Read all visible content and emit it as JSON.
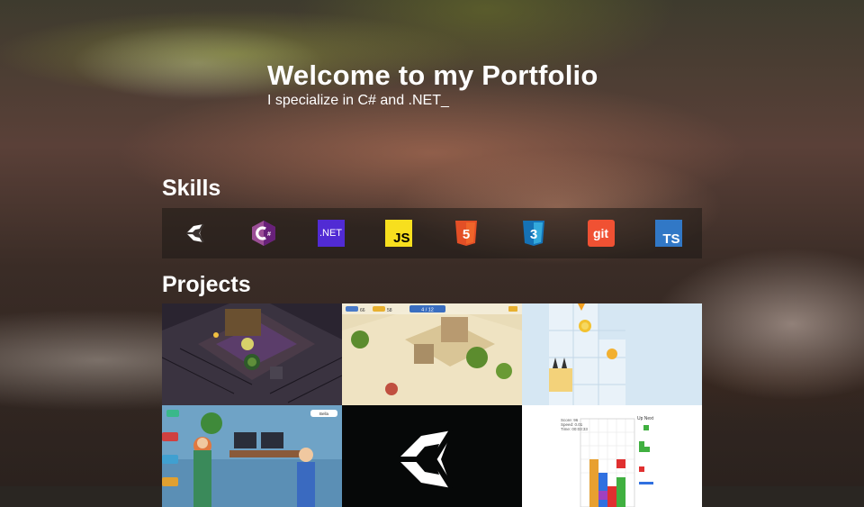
{
  "hero": {
    "title": "Welcome to my Portfolio",
    "subtitle": "I specialize in C# and .NET_"
  },
  "skills": {
    "heading": "Skills",
    "items": [
      {
        "name": "Unity",
        "icon": "unity-icon"
      },
      {
        "name": "C#",
        "icon": "csharp-icon",
        "color": "#9b4f96"
      },
      {
        "name": ".NET",
        "icon": "dotnet-icon",
        "label": ".NET",
        "color": "#512bd4"
      },
      {
        "name": "JavaScript",
        "icon": "javascript-icon",
        "label": "JS",
        "color": "#f7df1e"
      },
      {
        "name": "HTML5",
        "icon": "html5-icon",
        "label": "5",
        "color": "#e34f26"
      },
      {
        "name": "CSS3",
        "icon": "css3-icon",
        "label": "3",
        "color": "#1572b6"
      },
      {
        "name": "Git",
        "icon": "git-icon",
        "label": "git",
        "color": "#f05133"
      },
      {
        "name": "TypeScript",
        "icon": "typescript-icon",
        "label": "TS",
        "color": "#3178c6"
      }
    ]
  },
  "projects": {
    "heading": "Projects",
    "items": [
      {
        "name": "dungeon-game",
        "image": "dark isometric dungeon scene"
      },
      {
        "name": "desert-game",
        "image": "isometric desert village with palm trees",
        "hud": {
          "gems": "66",
          "coins": "58",
          "progress": "4 / 12"
        }
      },
      {
        "name": "puzzle-game",
        "image": "light blue puzzle grid with coin and spikes"
      },
      {
        "name": "office-game",
        "image": "cartoon office with characters",
        "tag": "Bella"
      },
      {
        "name": "unity-project",
        "image": "unity logo on black"
      },
      {
        "name": "tetris-game",
        "image": "tetris board",
        "panel": [
          "Score: 96",
          "Speed: 0.01",
          "Time: 00:03:33"
        ],
        "next_label": "Up Next"
      }
    ]
  }
}
